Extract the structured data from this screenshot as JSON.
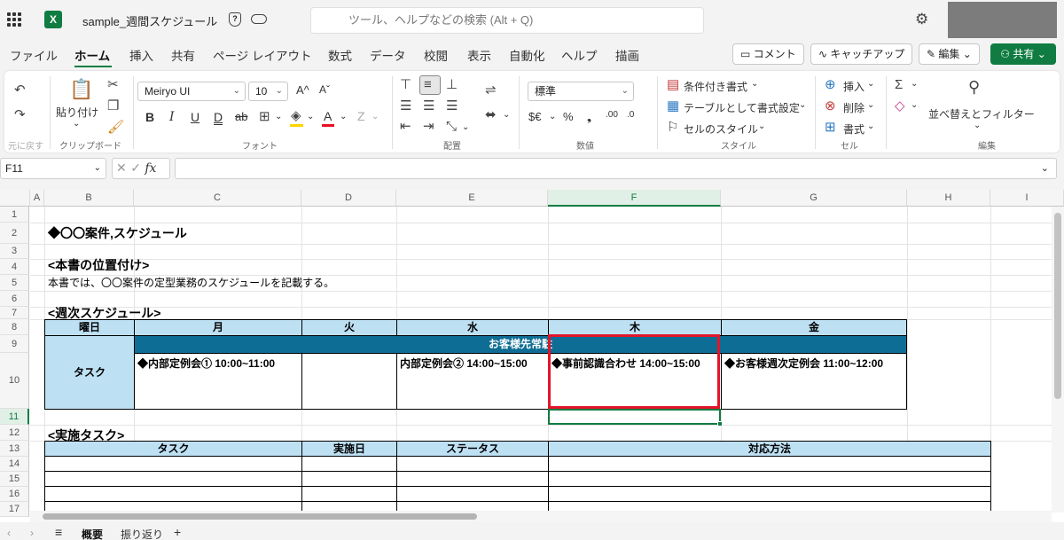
{
  "app": {
    "logo_letter": "X",
    "doc_title": "sample_週間スケジュール",
    "shield_glyph": "?",
    "search_placeholder": "ツール、ヘルプなどの検索 (Alt + Q)",
    "brand_color": "#107c41"
  },
  "menu": {
    "tabs": [
      "ファイル",
      "ホーム",
      "挿入",
      "共有",
      "ページ レイアウト",
      "数式",
      "データ",
      "校閲",
      "表示",
      "自動化",
      "ヘルプ",
      "描画"
    ],
    "active_tab": "ホーム",
    "comment": "コメント",
    "catchup": "キャッチアップ",
    "edit": "編集",
    "share": "共有"
  },
  "ribbon": {
    "undo_group": "元に戻す",
    "paste": "貼り付け",
    "clipboard_group": "クリップボード",
    "font_name": "Meiryo UI",
    "font_size": "10",
    "font_group": "フォント",
    "align_group": "配置",
    "number_format": "標準",
    "number_group": "数値",
    "conditional_format": "条件付き書式",
    "table_format": "テーブルとして書式設定",
    "cell_style": "セルのスタイル",
    "style_group": "スタイル",
    "insert": "挿入",
    "delete": "削除",
    "format": "書式",
    "cells_group": "セル",
    "sort_filter": "並べ替えとフィルター",
    "edit_group": "編集"
  },
  "formula_bar": {
    "name_box": "F11",
    "fx": "fx",
    "value": ""
  },
  "columns": [
    "A",
    "B",
    "C",
    "D",
    "E",
    "F",
    "G",
    "H",
    "I"
  ],
  "active_column": "F",
  "rows": [
    "1",
    "2",
    "3",
    "4",
    "5",
    "6",
    "7",
    "8",
    "9",
    "10",
    "11",
    "12",
    "13",
    "14",
    "15",
    "16",
    "17"
  ],
  "active_row": "11",
  "sheet": {
    "title": "◆〇〇案件,スケジュール",
    "heading_position": "<本書の位置付け>",
    "description": "本書では、〇〇案件の定型業務のスケジュールを記載する。",
    "heading_weekly": "<週次スケジュール>",
    "weekly_headers": [
      "曜日",
      "月",
      "火",
      "水",
      "木",
      "金"
    ],
    "banner": "お客様先常駐",
    "task_label": "タスク",
    "tasks": {
      "mon": "◆内部定例会①  10:00~11:00",
      "tue": "",
      "wed": "内部定例会②  14:00~15:00",
      "thu": "◆事前認識合わせ 14:00~15:00",
      "fri": "◆お客様週次定例会  11:00~12:00"
    },
    "heading_tasks": "<実施タスク>",
    "task_headers": [
      "タスク",
      "実施日",
      "ステータス",
      "対応方法"
    ]
  },
  "sheet_tabs": {
    "active": "概要",
    "other": "振り返り",
    "add": "+"
  }
}
